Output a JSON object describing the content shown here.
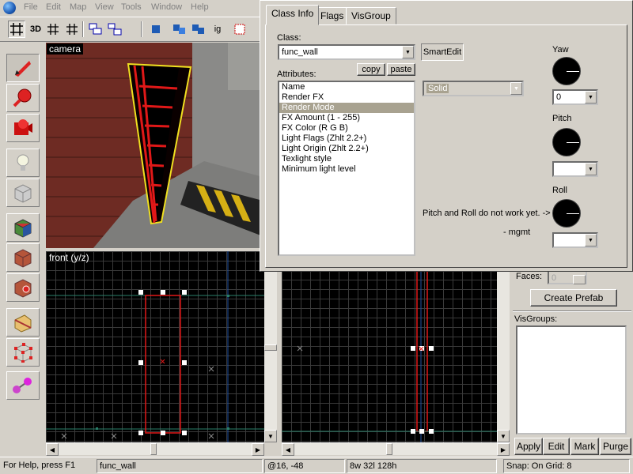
{
  "menu": {
    "items": [
      "File",
      "Edit",
      "Map",
      "View",
      "Tools",
      "Window",
      "Help"
    ]
  },
  "toolbar": {
    "btn_3d": "3D",
    "btn_ig": "ig"
  },
  "viewports": {
    "camera_label": "camera",
    "front_label": "front (y/z)"
  },
  "dialog": {
    "tabs": [
      "Class Info",
      "Flags",
      "VisGroup"
    ],
    "class_label": "Class:",
    "class_value": "func_wall",
    "smartedit_label": "SmartEdit",
    "attributes_label": "Attributes:",
    "copy_label": "copy",
    "paste_label": "paste",
    "attributes": [
      "Name",
      "Render FX",
      "Render Mode",
      "FX Amount (1 - 255)",
      "FX Color (R G B)",
      "Light Flags (Zhlt 2.2+)",
      "Light Origin (Zhlt 2.2+)",
      "Texlight style",
      "Minimum light level"
    ],
    "selected_attribute": "Render Mode",
    "value_combo": "Solid",
    "yaw_label": "Yaw",
    "yaw_value": "0",
    "pitch_label": "Pitch",
    "pitch_value": "",
    "roll_label": "Roll",
    "roll_value": "",
    "note_line1": "Pitch and Roll do not work yet. ->",
    "note_line2": "- mgmt"
  },
  "right_panel": {
    "faces_label": "Faces:",
    "faces_value": "0",
    "create_prefab": "Create Prefab",
    "visgroups_label": "VisGroups:",
    "apply": "Apply",
    "edit": "Edit",
    "mark": "Mark",
    "purge": "Purge"
  },
  "status": {
    "help": "For Help, press F1",
    "selection": "func_wall",
    "coords": "@16, -48",
    "size": "8w 32l 128h",
    "snap": "Snap: On Grid: 8"
  },
  "colors": {
    "selection": "#ff2020",
    "selected_row": "#a8a290"
  }
}
